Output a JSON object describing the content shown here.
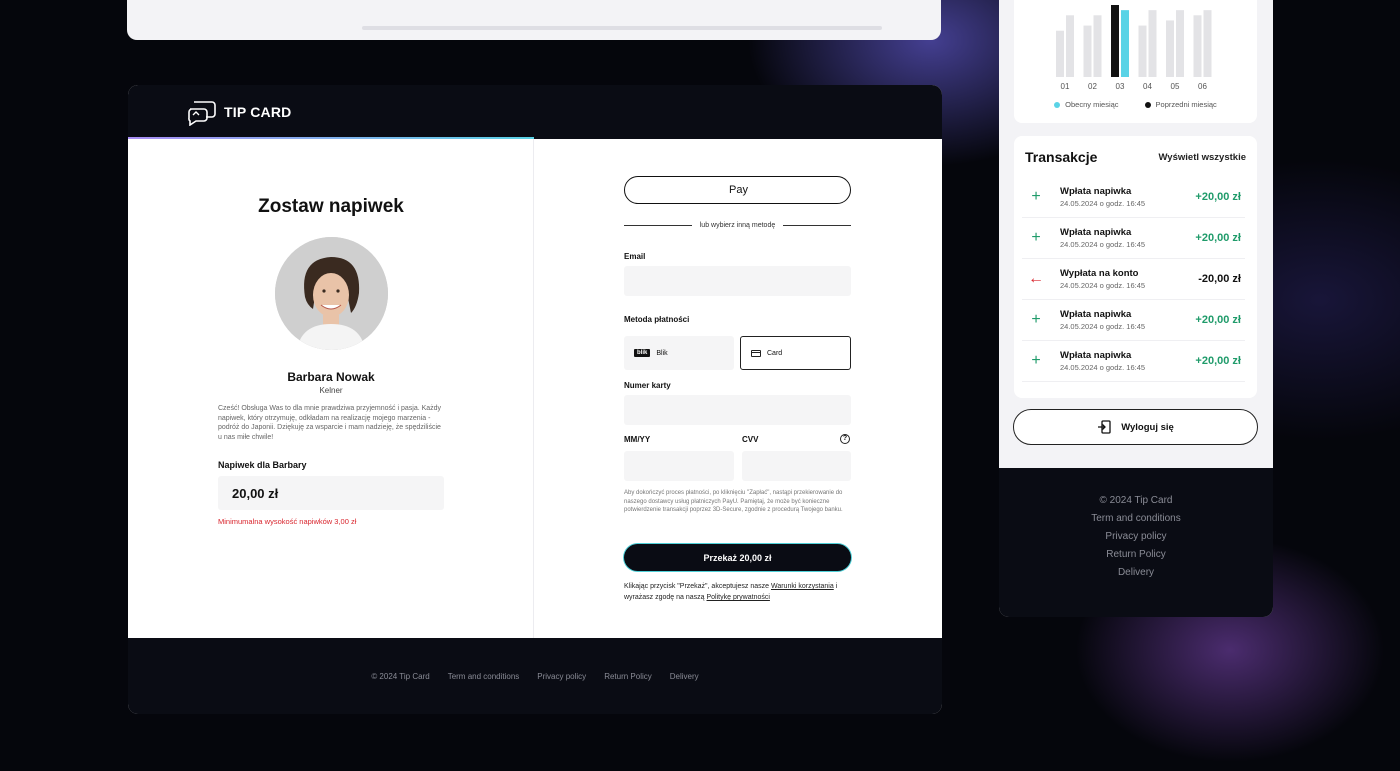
{
  "main": {
    "brand": "TIP CARD",
    "title": "Zostaw napiwek",
    "person": {
      "name": "Barbara Nowak",
      "role": "Kelner",
      "message": "Cześć! Obsługa Was to dla mnie prawdziwa przyjemność i pasja. Każdy napiwek, który otrzymuję, odkładam na realizację mojego marzenia - podróż do Japonii. Dziękuję za wsparcie i mam nadzieję, że spędziliście u nas miłe chwile!"
    },
    "tip_label": "Napiwek dla Barbary",
    "tip_amount": "20,00 zł",
    "tip_min": "Minimumalna wysokość napiwków 3,00 zł",
    "apple_pay_label": "Pay",
    "divider_text": "lub wybierz inną metodę",
    "email_label": "Email",
    "method_label": "Metoda płatności",
    "methods": [
      {
        "badge": "blik",
        "label": "Blik"
      },
      {
        "label": "Card"
      }
    ],
    "card_number_label": "Numer karty",
    "expiry_label": "MM/YY",
    "cvv_label": "CVV",
    "help_glyph": "?",
    "pay_note": "Aby dokończyć proces płatności, po kliknięciu \"Zapłać\", nastąpi przekierowanie do naszego dostawcy usług płatniczych PayU. Pamiętaj, że może być konieczne potwierdzenie transakcji poprzez 3D-Secure, zgodnie z procedurą Twojego banku.",
    "pay_button": "Przekaż 20,00 zł",
    "terms": {
      "part1": "Klikając przycisk \"Przekaż\", akceptujesz nasze ",
      "link1": "Warunki korzystania",
      "part2": " i wyrażasz zgodę na naszą ",
      "link2": "Politykę prywatności"
    },
    "footer": [
      "© 2024  Tip Card",
      "Term and conditions",
      "Privacy policy",
      "Return Policy",
      "Delivery"
    ]
  },
  "sidebar": {
    "legend": [
      {
        "label": "Obecny miesiąc",
        "color": "#5ad3e6"
      },
      {
        "label": "Poprzedni miesiąc",
        "color": "#111111"
      }
    ],
    "transactions_title": "Transakcje",
    "show_all": "Wyświetl wszystkie",
    "transactions": [
      {
        "icon": "plus-icon",
        "name": "Wpłata napiwka",
        "date": "24.05.2024 o godz. 16:45",
        "amount": "+20,00 zł",
        "type": "in"
      },
      {
        "icon": "plus-icon",
        "name": "Wpłata napiwka",
        "date": "24.05.2024 o godz. 16:45",
        "amount": "+20,00 zł",
        "type": "in"
      },
      {
        "icon": "arrow-left-icon",
        "name": "Wypłata na konto",
        "date": "24.05.2024 o godz. 16:45",
        "amount": "-20,00 zł",
        "type": "out"
      },
      {
        "icon": "plus-icon",
        "name": "Wpłata napiwka",
        "date": "24.05.2024 o godz. 16:45",
        "amount": "+20,00 zł",
        "type": "in"
      },
      {
        "icon": "plus-icon",
        "name": "Wpłata napiwka",
        "date": "24.05.2024 o godz. 16:45",
        "amount": "+20,00 zł",
        "type": "in"
      }
    ],
    "logout": "Wyloguj się",
    "footer": [
      "© 2024  Tip Card",
      "Term and conditions",
      "Privacy policy",
      "Return Policy",
      "Delivery"
    ]
  },
  "chart_data": {
    "type": "bar",
    "categories": [
      "01",
      "02",
      "03",
      "04",
      "05",
      "06"
    ],
    "series": [
      {
        "values": [
          45,
          50,
          70,
          50,
          55,
          60
        ],
        "color": "#e3e3e6"
      },
      {
        "values": [
          60,
          60,
          65,
          65,
          65,
          65
        ],
        "color": "#e3e3e6"
      }
    ],
    "highlight_index": 2,
    "highlight_colors": [
      "#111111",
      "#5ad3e6"
    ],
    "ylim": [
      0,
      70
    ],
    "grid": false,
    "legend_position": "bottom"
  }
}
